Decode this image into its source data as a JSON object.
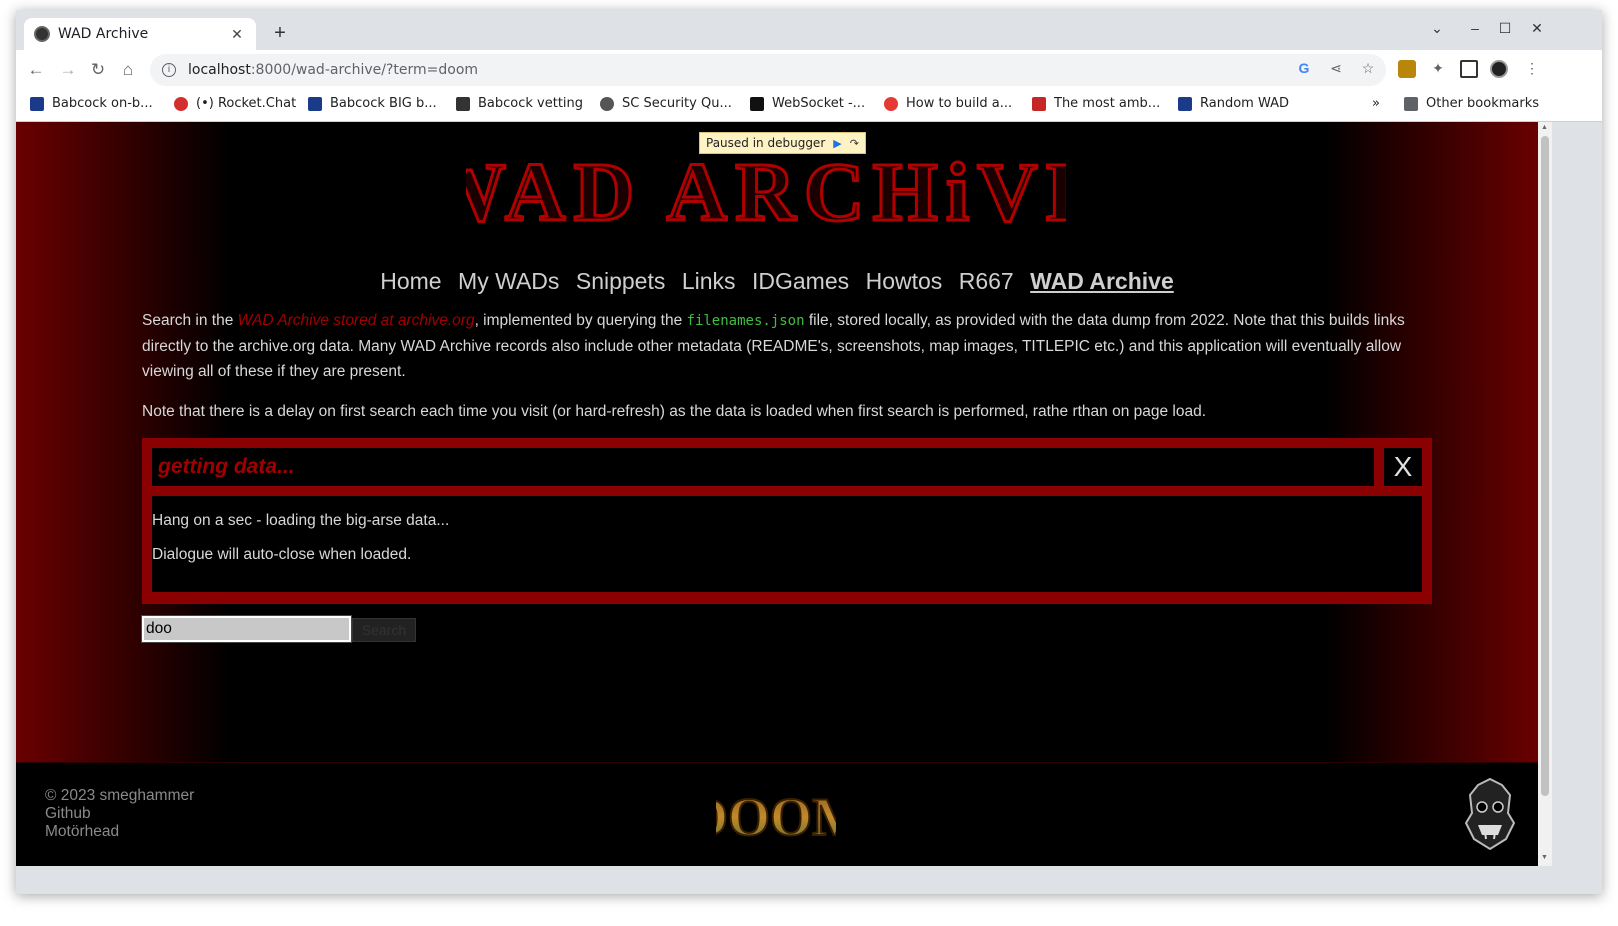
{
  "browser": {
    "tab_title": "WAD Archive",
    "url_host": "localhost",
    "url_path": ":8000/wad-archive/?term=doom",
    "bookmarks": [
      {
        "label": "Babcock on-b...",
        "color": "#1a3a8a"
      },
      {
        "label": "(•) Rocket.Chat",
        "color": "#d32f2f"
      },
      {
        "label": "Babcock BIG b...",
        "color": "#1a3a8a"
      },
      {
        "label": "Babcock vetting",
        "color": "#333333"
      },
      {
        "label": "SC Security Qu...",
        "color": "#555555"
      },
      {
        "label": "WebSocket -...",
        "color": "#111111"
      },
      {
        "label": "How to build a...",
        "color": "#e53935"
      },
      {
        "label": "The most amb...",
        "color": "#c62828"
      },
      {
        "label": "Random WAD",
        "color": "#1a3a8a"
      }
    ],
    "more_bookmarks": "»",
    "other_bookmarks": "Other bookmarks"
  },
  "debugger": {
    "label": "Paused in debugger"
  },
  "logo": {
    "text": "WAD ARCHiVE"
  },
  "nav": {
    "items": [
      "Home",
      "My WADs",
      "Snippets",
      "Links",
      "IDGames",
      "Howtos",
      "R667",
      "WAD Archive"
    ],
    "active": "WAD Archive"
  },
  "intro": {
    "p1_start": "Search in the ",
    "p1_link": "WAD Archive stored at archive.org",
    "p1_mid": ", implemented by querying the ",
    "p1_code": "filenames.json",
    "p1_end": " file, stored locally, as provided with the data dump from 2022. Note that this builds links directly to the archive.org data. Many WAD Archive records also include other metadata (README's, screenshots, map images, TITLEPIC etc.) and this application will eventually allow viewing all of these if they are present.",
    "p2": "Note that there is a delay on first search each time you visit (or hard-refresh) as the data is loaded when first search is performed, rathe rthan on page load."
  },
  "dialog": {
    "title": "getting data...",
    "close": "X",
    "line1": "Hang on a sec - loading the big-arse data...",
    "line2": "Dialogue will auto-close when loaded."
  },
  "search": {
    "value": "doo",
    "button": "Search"
  },
  "footer": {
    "copyright": "© 2023 smeghammer",
    "github": "Github",
    "motorhead": "Motörhead",
    "doom_logo": "DOOM"
  }
}
